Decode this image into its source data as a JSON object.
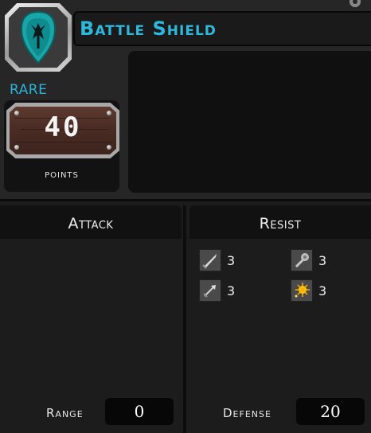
{
  "item": {
    "name": "Battle Shield",
    "rarity": "RARE",
    "points_value": "40",
    "points_label": "points",
    "emblem_icon": "shield-emblem-icon"
  },
  "colors": {
    "accent": "#2fb8de",
    "panel": "#262626",
    "background": "#1c1c1c"
  },
  "attack": {
    "title": "Attack",
    "range_label": "Range",
    "range_value": "0"
  },
  "resist": {
    "title": "Resist",
    "items": [
      {
        "icon": "sword-icon",
        "value": "3"
      },
      {
        "icon": "mace-icon",
        "value": "3"
      },
      {
        "icon": "arrow-icon",
        "value": "3"
      },
      {
        "icon": "spark-icon",
        "value": "3"
      }
    ],
    "defense_label": "Defense",
    "defense_value": "20"
  }
}
